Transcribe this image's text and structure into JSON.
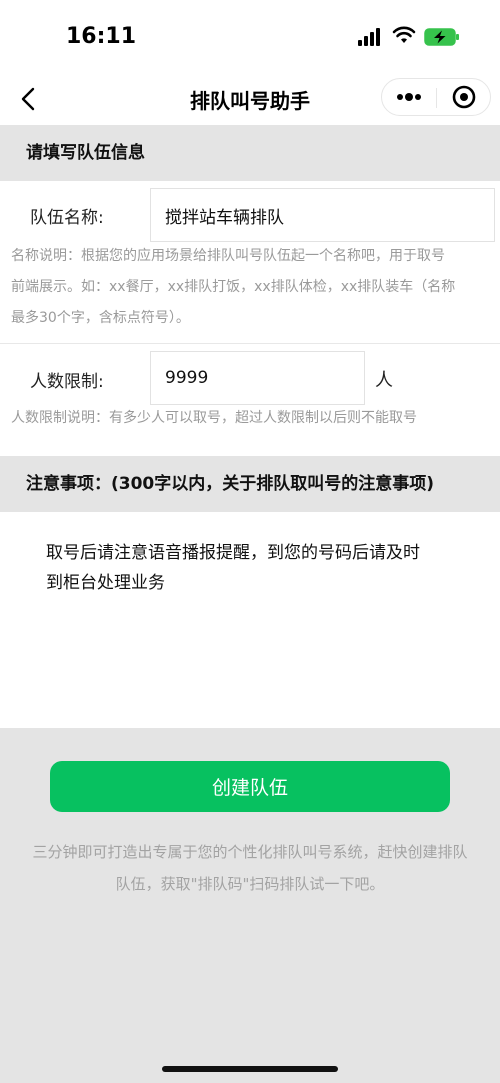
{
  "status_bar": {
    "time": "16:11"
  },
  "nav": {
    "title": "排队叫号助手",
    "back_icon": "chevron-left-icon",
    "more_icon": "more-dots-icon",
    "close_icon": "target-circle-icon"
  },
  "section_team": {
    "title": "请填写队伍信息"
  },
  "team_name": {
    "label": "队伍名称:",
    "value": "搅拌站车辆排队",
    "hint_lines": [
      "名称说明：根据您的应用场景给排队叫号队伍起一个名称吧，用于取号",
      "前端展示。如：xx餐厅，xx排队打饭，xx排队体检，xx排队装车（名称",
      "最多30个字，含标点符号）。"
    ]
  },
  "people_limit": {
    "label": "人数限制:",
    "value": "9999",
    "unit": "人",
    "hint": "人数限制说明：有多少人可以取号，超过人数限制以后则不能取号"
  },
  "section_notes": {
    "title": "注意事项：(300字以内，关于排队取叫号的注意事项)"
  },
  "notes": {
    "line1": "取号后请注意语音播报提醒，到您的号码后请及时",
    "line2": "到柜台处理业务"
  },
  "actions": {
    "create_label": "创建队伍"
  },
  "promo": {
    "line1": "三分钟即可打造出专属于您的个性化排队叫号系统，赶快创建排队",
    "line2": "队伍，获取\"排队码\"扫码排队试一下吧。"
  },
  "colors": {
    "accent": "#07c160",
    "background": "#e4e4e4"
  }
}
